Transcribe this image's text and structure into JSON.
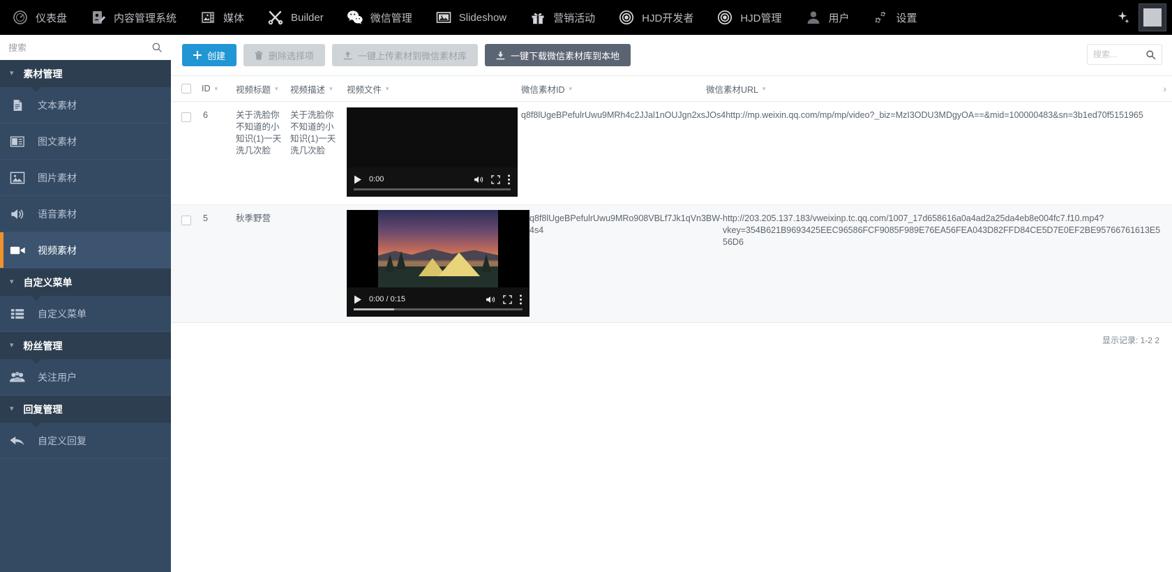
{
  "topnav": {
    "items": [
      {
        "label": "仪表盘",
        "icon": "dashboard-icon"
      },
      {
        "label": "内容管理系统",
        "icon": "cms-icon"
      },
      {
        "label": "媒体",
        "icon": "media-icon"
      },
      {
        "label": "Builder",
        "icon": "builder-icon"
      },
      {
        "label": "微信管理",
        "icon": "wechat-icon"
      },
      {
        "label": "Slideshow",
        "icon": "slideshow-icon"
      },
      {
        "label": "营销活动",
        "icon": "gift-icon"
      },
      {
        "label": "HJD开发者",
        "icon": "target-icon"
      },
      {
        "label": "HJD管理",
        "icon": "target-icon"
      },
      {
        "label": "用户",
        "icon": "user-icon"
      },
      {
        "label": "设置",
        "icon": "gear-icon"
      }
    ],
    "active_index": 4,
    "spark_icon": "sparkle-icon",
    "avatar": "avatar-image"
  },
  "sidebar": {
    "search_placeholder": "搜索",
    "search_value": "",
    "search_icon": "search-icon",
    "groups": [
      {
        "title": "素材管理",
        "items": [
          {
            "label": "文本素材",
            "icon": "document-icon",
            "active": false
          },
          {
            "label": "图文素材",
            "icon": "news-icon",
            "active": false
          },
          {
            "label": "图片素材",
            "icon": "image-icon",
            "active": false
          },
          {
            "label": "语音素材",
            "icon": "speaker-icon",
            "active": false
          },
          {
            "label": "视频素材",
            "icon": "video-camera-icon",
            "active": true
          }
        ]
      },
      {
        "title": "自定义菜单",
        "items": [
          {
            "label": "自定义菜单",
            "icon": "list-icon",
            "active": false
          }
        ]
      },
      {
        "title": "粉丝管理",
        "items": [
          {
            "label": "关注用户",
            "icon": "users-icon",
            "active": false
          }
        ]
      },
      {
        "title": "回复管理",
        "items": [
          {
            "label": "自定义回复",
            "icon": "reply-arrow-icon",
            "active": false
          }
        ]
      }
    ]
  },
  "toolbar": {
    "create_label": "创建",
    "create_icon": "plus-icon",
    "delete_label": "删除选择项",
    "delete_icon": "trash-icon",
    "upload_label": "一键上传素材到微信素材库",
    "upload_icon": "upload-icon",
    "download_label": "一键下载微信素材库到本地",
    "download_icon": "download-icon",
    "search_placeholder": "搜索...",
    "search_value": "",
    "search_icon": "search-icon",
    "accent_color": "#2196d4",
    "dark_button_color": "#5b6472"
  },
  "table": {
    "columns": [
      {
        "label": "ID",
        "sortable": true
      },
      {
        "label": "视频标题",
        "sortable": true
      },
      {
        "label": "视频描述",
        "sortable": true
      },
      {
        "label": "视频文件",
        "sortable": true
      },
      {
        "label": "微信素材ID",
        "sortable": true
      },
      {
        "label": "微信素材URL",
        "sortable": true
      }
    ],
    "expand_icon": "chevron-right-icon",
    "rows": [
      {
        "id": "6",
        "title": "关于洗脸你不知道的小知识(1)一天洗几次脸",
        "description": "关于洗脸你不知道的小知识(1)一天洗几次脸",
        "media_id": "q8f8lUgeBPefulrUwu9MRh4c2JJal1nOUJgn2xsJOs4",
        "media_url": "http://mp.weixin.qq.com/mp/mp/video?_biz=MzI3ODU3MDgyOA==&mid=100000483&sn=3b1ed70f5151965",
        "video": {
          "current_time": "0:00",
          "duration": "",
          "time_display": "0:00",
          "progress_percent": 0,
          "has_poster": false,
          "play_icon": "play-icon",
          "volume_icon": "volume-icon",
          "fullscreen_icon": "fullscreen-icon",
          "menu_icon": "kebab-menu-icon"
        }
      },
      {
        "id": "5",
        "title": "秋季野营",
        "description": "",
        "media_id": "q8f8lUgeBPefulrUwu9MRo908VBLf7Jk1qVn3BW-4s4",
        "media_url": "http://203.205.137.183/vweixinp.tc.qq.com/1007_17d658616a0a4ad2a25da4eb8e004fc7.f10.mp4?vkey=354B621B9693425EEC96586FCF9085F989E76EA56FEA043D82FFD84CE5D7E0EF2BE95766761613E556D6",
        "video": {
          "current_time": "0:00",
          "duration": "0:15",
          "time_display": "0:00 / 0:15",
          "progress_percent": 24,
          "has_poster": true,
          "play_icon": "play-icon",
          "volume_icon": "volume-icon",
          "fullscreen_icon": "fullscreen-icon",
          "menu_icon": "kebab-menu-icon"
        }
      }
    ]
  },
  "footer": {
    "records_text": "显示记录: 1-2 2"
  }
}
